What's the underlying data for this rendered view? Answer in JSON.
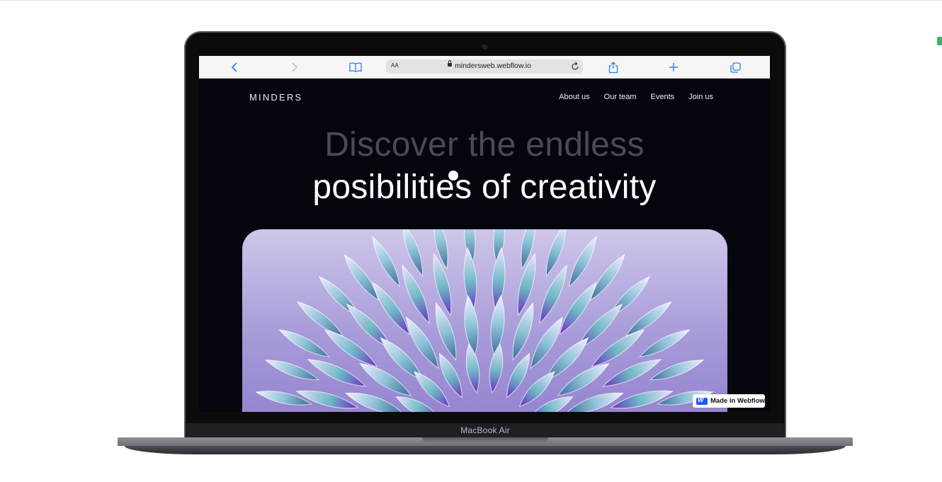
{
  "browser": {
    "text_size_label": "AA",
    "url": "mindersweb.webflow.io",
    "accent_color": "#2f7cf6"
  },
  "site": {
    "logo": "MINDERS",
    "nav": [
      "About us",
      "Our team",
      "Events",
      "Join us"
    ],
    "headline_line1": "Discover the endless",
    "headline_line2": "posibilities of creativity",
    "badge": "Made in Webflow"
  },
  "device": {
    "label": "MacBook Air"
  },
  "colors": {
    "page_bg": "#05050d",
    "headline_dim": "#4a4a55",
    "headline_bright": "#ffffff",
    "image_bg": "#a89bd9"
  }
}
